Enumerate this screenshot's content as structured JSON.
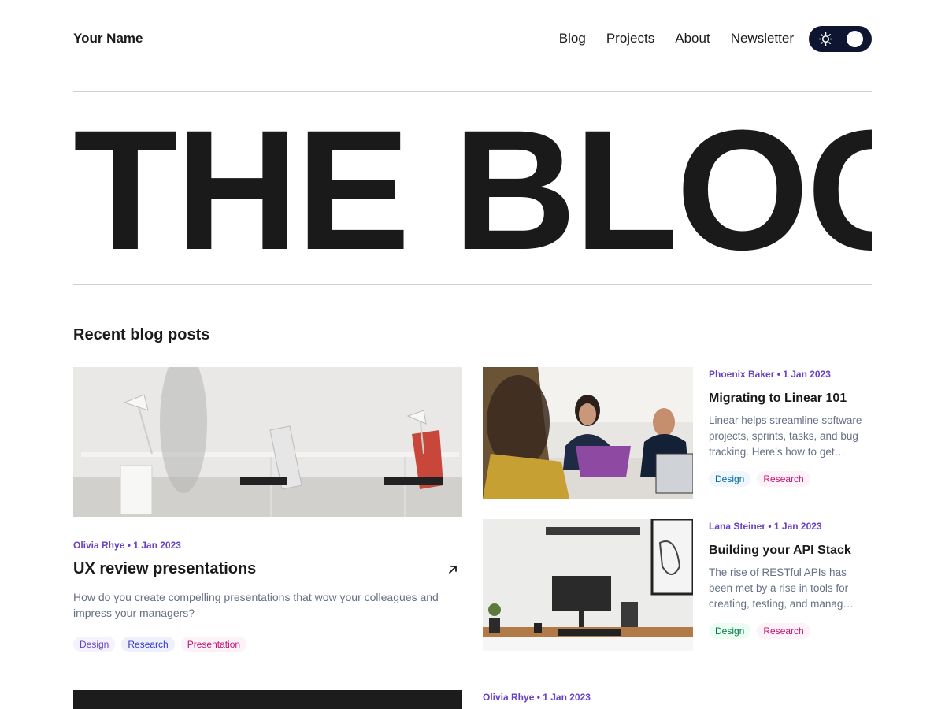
{
  "nav": {
    "brand": "Your Name",
    "links": [
      "Blog",
      "Projects",
      "About",
      "Newsletter"
    ],
    "theme_toggle": {
      "icon": "sun-icon",
      "state": "dark"
    }
  },
  "hero": {
    "title": "THE BLOG"
  },
  "section": {
    "title": "Recent blog posts"
  },
  "posts": [
    {
      "meta": "Olivia Rhye • 1 Jan 2023",
      "title": "UX review presentations",
      "description": "How do you create compelling presentations that wow your colleagues and impress your managers?",
      "tags": [
        "Design",
        "Research",
        "Presentation"
      ],
      "image": "office-desks-photo",
      "icon": "arrow-up-right-icon"
    },
    {
      "meta": "Phoenix Baker • 1 Jan 2023",
      "title": "Migrating to Linear 101",
      "description": "Linear helps streamline software projects, sprints, tasks, and bug tracking. Here’s how to get…",
      "tags": [
        "Design",
        "Research"
      ],
      "image": "team-laptop-photo"
    },
    {
      "meta": "Lana Steiner • 1 Jan 2023",
      "title": "Building your API Stack",
      "description": "The rise of RESTful APIs has been met by a rise in tools for creating, testing, and manag…",
      "tags": [
        "Design",
        "Research"
      ],
      "image": "desk-monitor-photo"
    },
    {
      "meta": "Olivia Rhye • 1 Jan 2023",
      "image": "dark-photo"
    }
  ],
  "colors": {
    "accent": "#6941c6",
    "text": "#1a1a1a",
    "muted": "#667085",
    "toggle_bg": "#0e1531"
  }
}
